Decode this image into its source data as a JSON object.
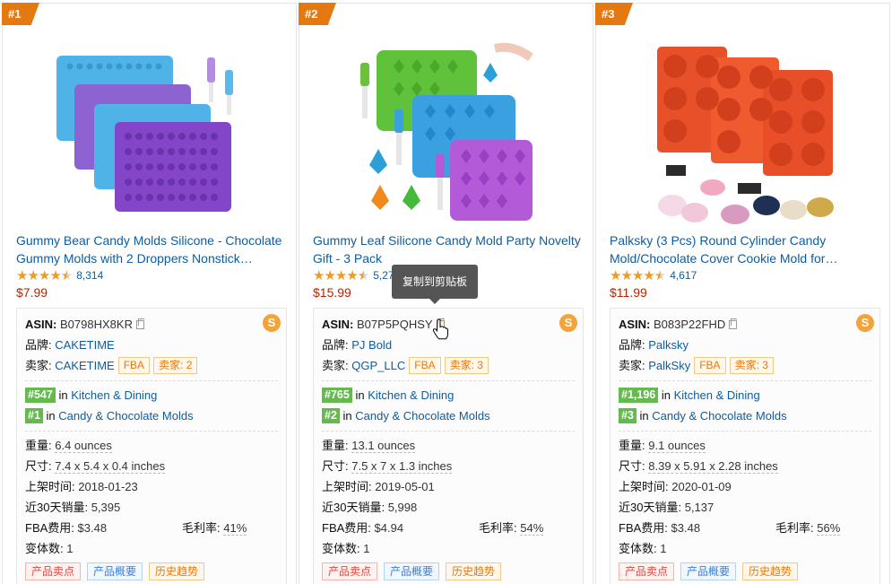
{
  "cards": [
    {
      "rank": "#1",
      "title": "Gummy Bear Candy Molds Silicone - Chocolate Gummy Molds with 2 Droppers Nonstick…",
      "reviews": "8,314",
      "price": "$7.99",
      "asin_label": "ASIN:",
      "asin": "B0798HX8KR",
      "brand_label": "品牌:",
      "brand": "CAKETIME",
      "seller_label": "卖家:",
      "seller": "CAKETIME",
      "fba": "FBA",
      "sellers": "卖家: 2",
      "rank1": "#547",
      "in1": "in",
      "cat1": "Kitchen & Dining",
      "rank2": "#1",
      "in2": "in",
      "cat2": "Candy & Chocolate Molds",
      "weight_label": "重量:",
      "weight": "6.4 ounces",
      "size_label": "尺寸:",
      "size": "7.4 x 5.4 x 0.4 inches",
      "date_label": "上架时间:",
      "date": "2018-01-23",
      "sales_label": "近30天销量:",
      "sales": "5,395",
      "fee_label": "FBA费用:",
      "fee": "$3.48",
      "margin_label": "毛利率:",
      "margin": "41%",
      "variants_label": "变体数:",
      "variants": "1",
      "btn1": "产品卖点",
      "btn2": "产品概要",
      "btn3": "历史趋势"
    },
    {
      "rank": "#2",
      "title": "Gummy Leaf Silicone Candy Mold Party Novelty Gift - 3 Pack",
      "reviews": "5,278",
      "price": "$15.99",
      "asin_label": "ASIN:",
      "asin": "B07P5PQHSY",
      "brand_label": "品牌:",
      "brand": "PJ Bold",
      "seller_label": "卖家:",
      "seller": "QGP_LLC",
      "fba": "FBA",
      "sellers": "卖家: 3",
      "rank1": "#765",
      "in1": "in",
      "cat1": "Kitchen & Dining",
      "rank2": "#2",
      "in2": "in",
      "cat2": "Candy & Chocolate Molds",
      "weight_label": "重量:",
      "weight": "13.1 ounces",
      "size_label": "尺寸:",
      "size": "7.5 x 7 x 1.3 inches",
      "date_label": "上架时间:",
      "date": "2019-05-01",
      "sales_label": "近30天销量:",
      "sales": "5,998",
      "fee_label": "FBA费用:",
      "fee": "$4.94",
      "margin_label": "毛利率:",
      "margin": "54%",
      "variants_label": "变体数:",
      "variants": "1",
      "btn1": "产品卖点",
      "btn2": "产品概要",
      "btn3": "历史趋势"
    },
    {
      "rank": "#3",
      "title": "Palksky (3 Pcs) Round Cylinder Candy Mold/Chocolate Cover Cookie Mold for…",
      "reviews": "4,617",
      "price": "$11.99",
      "asin_label": "ASIN:",
      "asin": "B083P22FHD",
      "brand_label": "品牌:",
      "brand": "Palksky",
      "seller_label": "卖家:",
      "seller": "PalkSky",
      "fba": "FBA",
      "sellers": "卖家: 3",
      "rank1": "#1,196",
      "in1": "in",
      "cat1": "Kitchen & Dining",
      "rank2": "#3",
      "in2": "in",
      "cat2": "Candy & Chocolate Molds",
      "weight_label": "重量:",
      "weight": "9.1 ounces",
      "size_label": "尺寸:",
      "size": "8.39 x 5.91 x 2.28 inches",
      "date_label": "上架时间:",
      "date": "2020-01-09",
      "sales_label": "近30天销量:",
      "sales": "5,137",
      "fee_label": "FBA费用:",
      "fee": "$3.48",
      "margin_label": "毛利率:",
      "margin": "56%",
      "variants_label": "变体数:",
      "variants": "1",
      "btn1": "产品卖点",
      "btn2": "产品概要",
      "btn3": "历史趋势"
    }
  ],
  "tooltip": "复制到剪贴板",
  "logo_glyph": "S",
  "colors": {
    "rank_badge": "#e47911",
    "link": "#0f5c9c",
    "price": "#b12704",
    "rank_tag": "#66b94f",
    "star": "#f29a1f"
  }
}
